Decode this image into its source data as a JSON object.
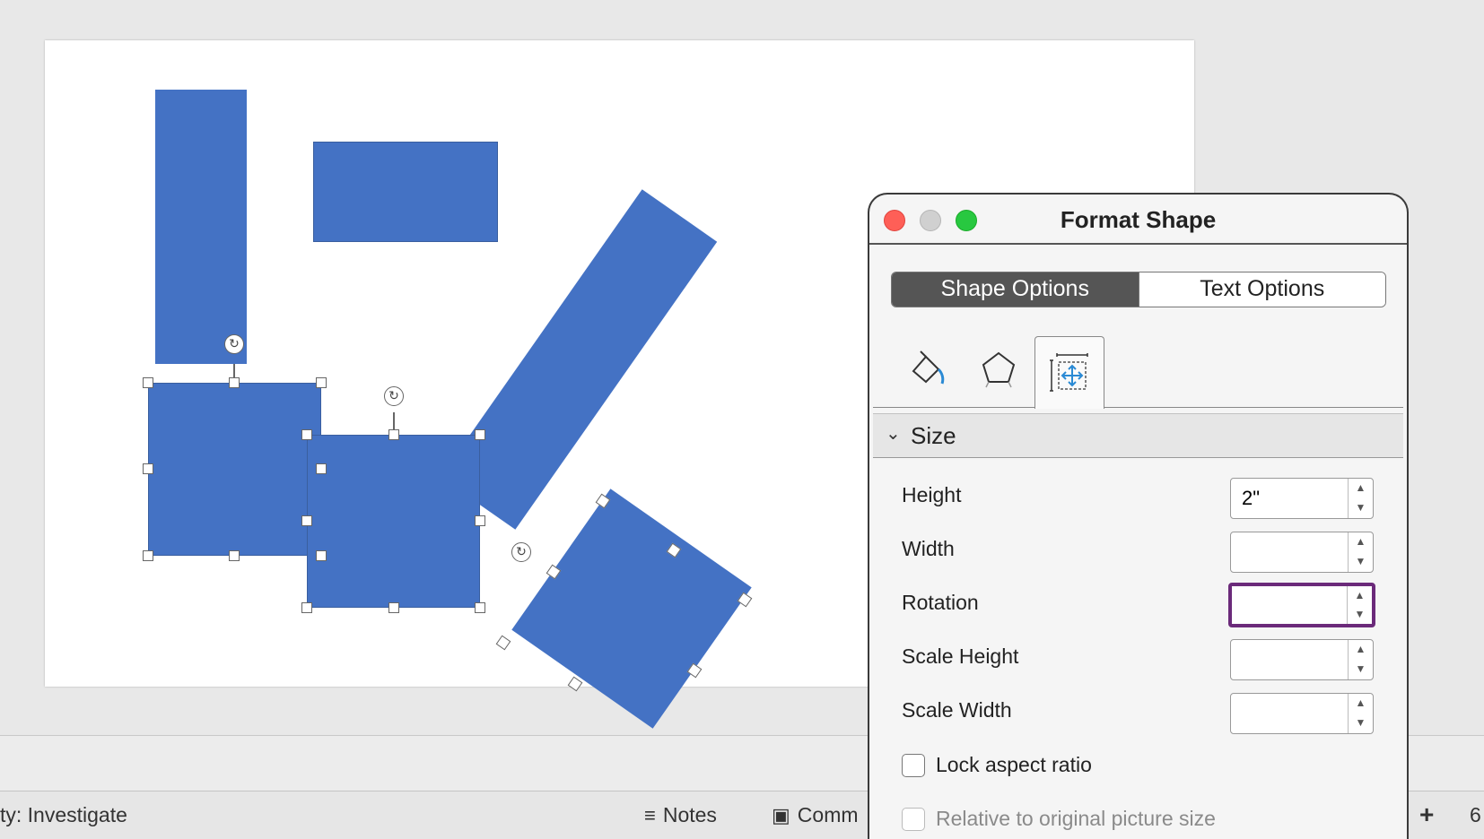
{
  "status_bar": {
    "accessibility_text": "ty: Investigate",
    "notes_label": "Notes",
    "comments_label": "Comm",
    "zoom_plus_label": "+",
    "zoom_partial": "6"
  },
  "format_panel": {
    "title": "Format Shape",
    "tabs": {
      "shape_options": "Shape Options",
      "text_options": "Text Options"
    },
    "icon_tabs": [
      "fill-line-icon",
      "effects-pentagon-icon",
      "size-properties-icon"
    ],
    "section_title": "Size",
    "fields": {
      "height": {
        "label": "Height",
        "value": "2\""
      },
      "width": {
        "label": "Width",
        "value": ""
      },
      "rotation": {
        "label": "Rotation",
        "value": ""
      },
      "scale_height": {
        "label": "Scale Height",
        "value": ""
      },
      "scale_width": {
        "label": "Scale Width",
        "value": ""
      }
    },
    "lock_aspect_ratio": {
      "label": "Lock aspect ratio",
      "checked": false
    },
    "relative_original": {
      "label": "Relative to original picture size",
      "checked": false,
      "enabled": false
    }
  },
  "colors": {
    "shape_fill": "#4472c4",
    "focus_ring": "#6b2a7a",
    "active_tab_bg": "#555555"
  }
}
